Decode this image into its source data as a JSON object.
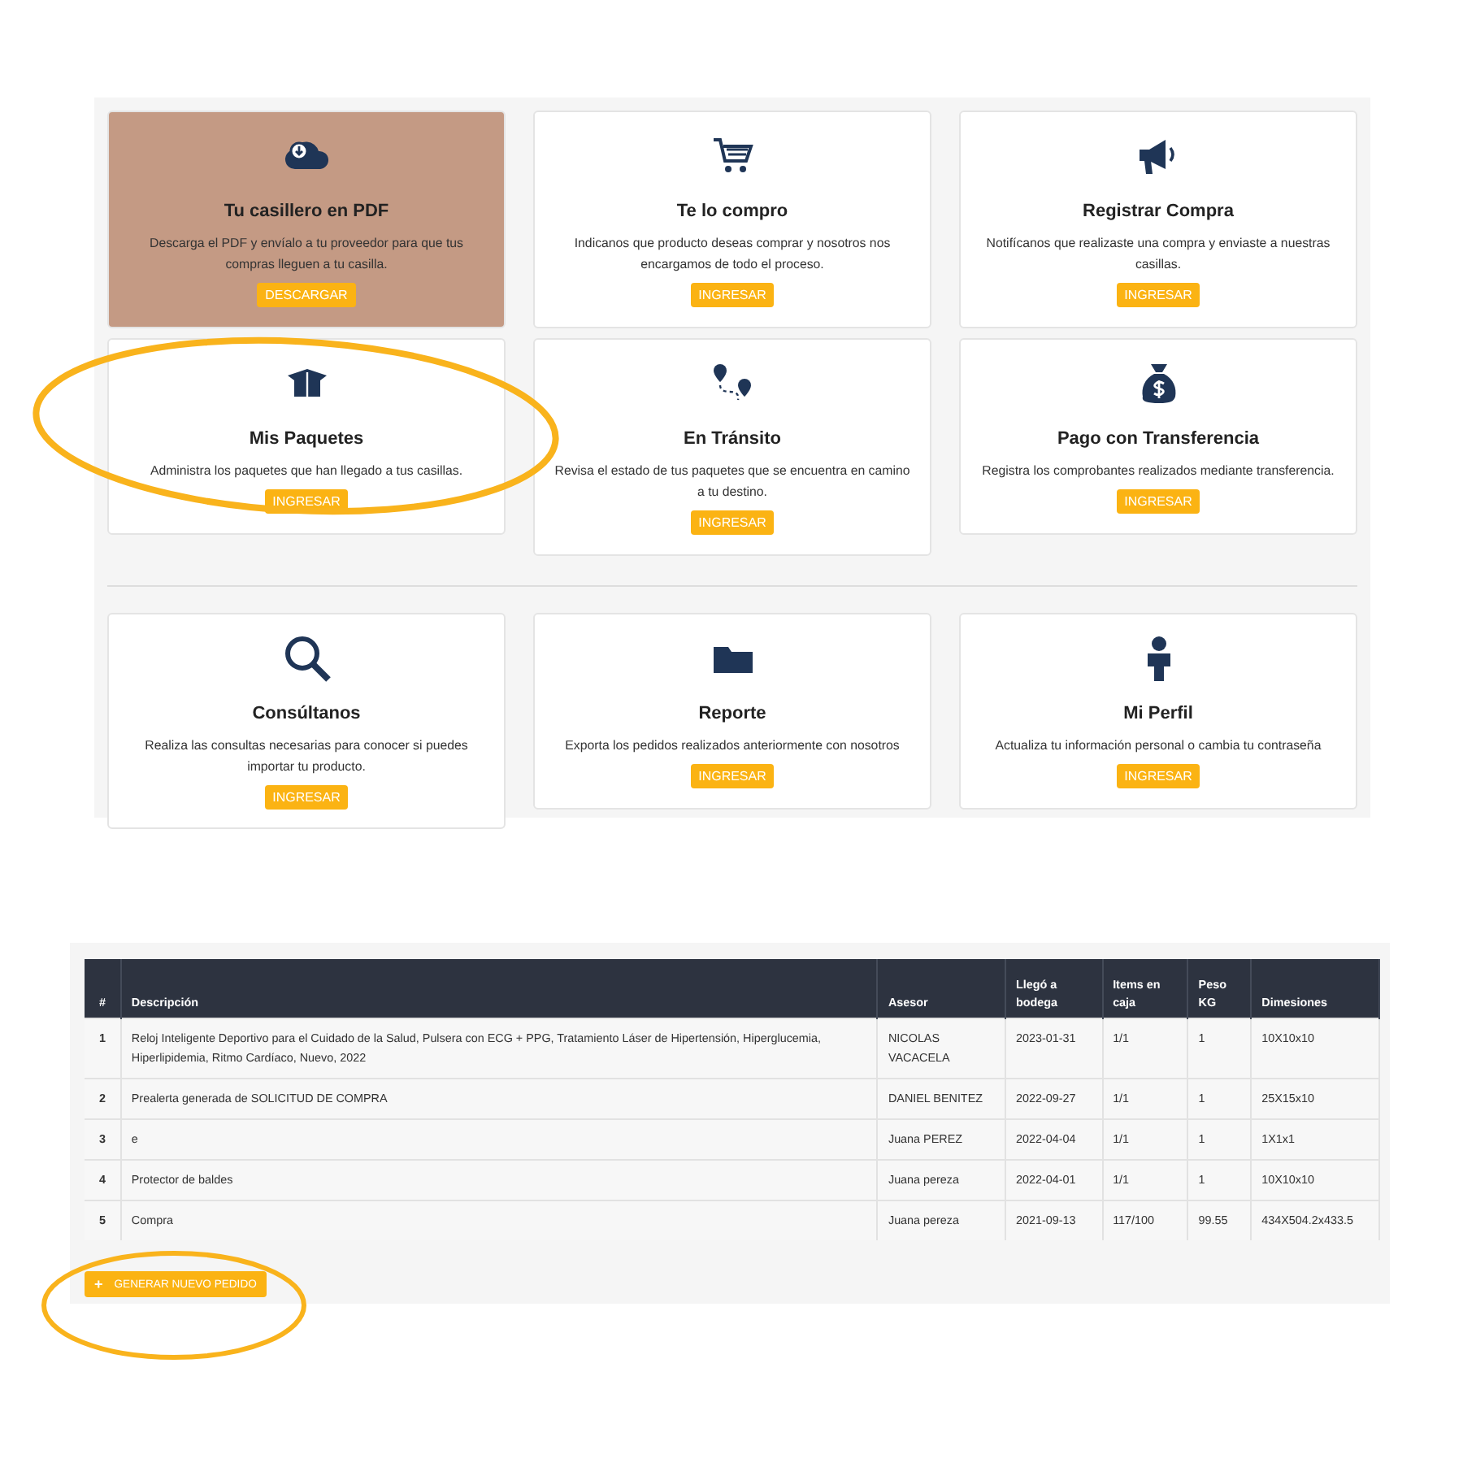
{
  "cards": [
    {
      "title": "Tu casillero en PDF",
      "description": "Descarga el PDF y envíalo a tu proveedor para que tus compras lleguen a tu casilla.",
      "button": "DESCARGAR",
      "highlighted": true
    },
    {
      "title": "Te lo compro",
      "description": "Indicanos que producto deseas comprar y nosotros nos encargamos de todo el proceso.",
      "button": "INGRESAR",
      "highlighted": false
    },
    {
      "title": "Registrar Compra",
      "description": "Notifícanos que realizaste una compra y enviaste a nuestras casillas.",
      "button": "INGRESAR",
      "highlighted": false
    },
    {
      "title": "Mis Paquetes",
      "description": "Administra los paquetes que han llegado a tus casillas.",
      "button": "INGRESAR",
      "highlighted": false
    },
    {
      "title": "En Tránsito",
      "description": "Revisa el estado de tus paquetes que se encuentra en camino a tu destino.",
      "button": "INGRESAR",
      "highlighted": false
    },
    {
      "title": "Pago con Transferencia",
      "description": "Registra los comprobantes realizados mediante transferencia.",
      "button": "INGRESAR",
      "highlighted": false
    },
    {
      "title": "Consúltanos",
      "description": "Realiza las consultas necesarias para conocer si puedes importar tu producto.",
      "button": "INGRESAR",
      "highlighted": false
    },
    {
      "title": "Reporte",
      "description": "Exporta los pedidos realizados anteriormente con nosotros",
      "button": "INGRESAR",
      "highlighted": false
    },
    {
      "title": "Mi Perfil",
      "description": "Actualiza tu información personal o cambia tu contraseña",
      "button": "INGRESAR",
      "highlighted": false
    }
  ],
  "table": {
    "columns": [
      "#",
      "Descripción",
      "Asesor",
      "Llegó a bodega",
      "Items en caja",
      "Peso KG",
      "Dimesiones"
    ],
    "rows": [
      [
        "1",
        "Reloj Inteligente Deportivo para el Cuidado de la Salud, Pulsera con ECG + PPG, Tratamiento Láser de Hipertensión, Hiperglucemia, Hiperlipidemia, Ritmo Cardíaco, Nuevo, 2022",
        "NICOLAS VACACELA",
        "2023-01-31",
        "1/1",
        "1",
        "10X10x10"
      ],
      [
        "2",
        "Prealerta generada de SOLICITUD DE COMPRA",
        "DANIEL BENITEZ",
        "2022-09-27",
        "1/1",
        "1",
        "25X15x10"
      ],
      [
        "3",
        "e",
        "Juana PEREZ",
        "2022-04-04",
        "1/1",
        "1",
        "1X1x1"
      ],
      [
        "4",
        "Protector de baldes",
        "Juana pereza",
        "2022-04-01",
        "1/1",
        "1",
        "10X10x10"
      ],
      [
        "5",
        "Compra",
        "Juana pereza",
        "2021-09-13",
        "117/100",
        "99.55",
        "434X504.2x433.5"
      ]
    ]
  },
  "new_order_button": {
    "icon": "+",
    "label": "GENERAR NUEVO PEDIDO"
  }
}
